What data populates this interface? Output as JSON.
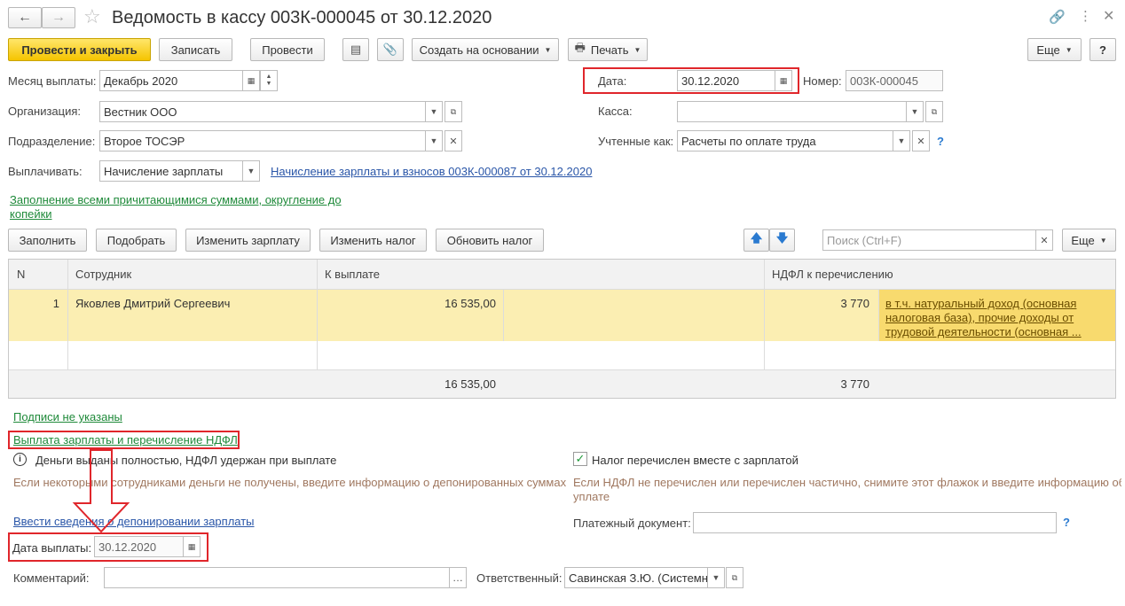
{
  "window": {
    "title": "Ведомость в кассу 003К-000045 от 30.12.2020"
  },
  "toolbar": {
    "post_close": "Провести и закрыть",
    "save": "Записать",
    "post": "Провести",
    "create_based": "Создать на основании",
    "print": "Печать",
    "more": "Еще",
    "help": "?"
  },
  "form": {
    "month_label": "Месяц выплаты:",
    "month_value": "Декабрь 2020",
    "date_label": "Дата:",
    "date_value": "30.12.2020",
    "number_label": "Номер:",
    "number_value": "003К-000045",
    "org_label": "Организация:",
    "org_value": "Вестник ООО",
    "cash_label": "Касса:",
    "cash_value": "",
    "dept_label": "Подразделение:",
    "dept_value": "Второе ТОСЭР",
    "accounted_label": "Учтенные как:",
    "accounted_value": "Расчеты по оплате труда",
    "pay_label": "Выплачивать:",
    "pay_value": "Начисление зарплаты",
    "pay_doc_link": "Начисление зарплаты и взносов 003К-000087 от 30.12.2020",
    "fill_link_line1": "Заполнение всеми причитающимися суммами, округление до",
    "fill_link_line2": "копейки"
  },
  "table_toolbar": {
    "fill": "Заполнить",
    "pick": "Подобрать",
    "change_salary": "Изменить зарплату",
    "change_tax": "Изменить налог",
    "update_tax": "Обновить налог",
    "search_placeholder": "Поиск (Ctrl+F)",
    "more": "Еще"
  },
  "table": {
    "headers": [
      "N",
      "Сотрудник",
      "К выплате",
      "НДФЛ к перечислению"
    ],
    "rows": [
      {
        "n": "1",
        "employee": "Яковлев Дмитрий Сергеевич",
        "to_pay": "16 535,00",
        "ndfl": "3 770",
        "note_line1": "в т.ч. натуральный доход (основная",
        "note_line2": "налоговая база), прочие доходы от",
        "note_line3": "трудовой деятельности (основная ..."
      }
    ],
    "totals": {
      "to_pay": "16 535,00",
      "ndfl": "3 770"
    }
  },
  "footer": {
    "signatures_link": "Подписи не указаны",
    "payment_link": "Выплата зарплаты и перечисление НДФЛ",
    "money_paid": "Деньги выданы полностью, НДФЛ удержан при выплате",
    "money_hint": "Если некоторыми сотрудниками деньги не получены, введите информацию о депонированных суммах",
    "deposit_link": "Ввести сведения о депонировании зарплаты",
    "tax_checkbox_label": "Налог перечислен вместе с зарплатой",
    "tax_hint_line1": "Если НДФЛ не перечислен или перечислен частично, снимите этот флажок и введите информацию об",
    "tax_hint_line2": "уплате",
    "payment_doc_label": "Платежный документ:",
    "payment_doc_value": "",
    "pay_date_label": "Дата выплаты:",
    "pay_date_value": "30.12.2020",
    "comment_label": "Комментарий:",
    "comment_value": "",
    "responsible_label": "Ответственный:",
    "responsible_value": "Савинская З.Ю. (Системн"
  },
  "colors": {
    "accent_yellow": "#f5c400",
    "highlight_red": "#e0262b",
    "link_blue": "#2a56a8",
    "link_green": "#1f8a3a",
    "row_selected": "#fbeeb2"
  }
}
